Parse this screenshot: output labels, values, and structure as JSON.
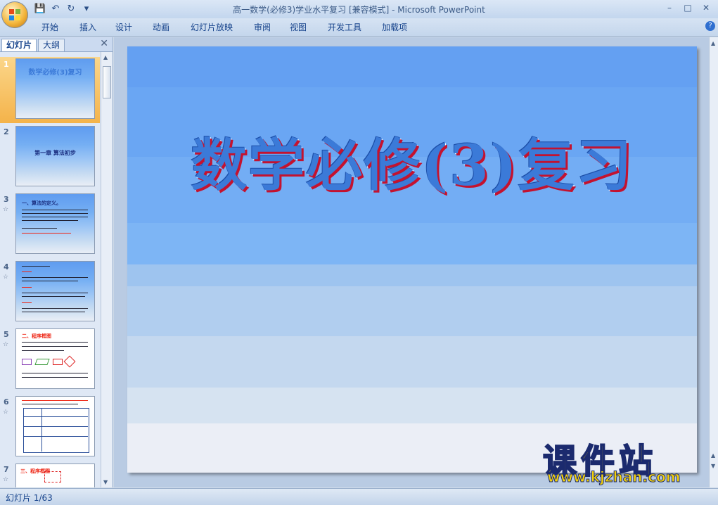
{
  "window": {
    "title": "高一数学(必修3)学业水平复习 [兼容模式] - Microsoft PowerPoint"
  },
  "qat": {
    "save_icon": "save-icon",
    "undo_icon": "undo-icon",
    "redo_icon": "redo-icon",
    "more_icon": "chevron-down-icon"
  },
  "ribbon_tabs": [
    "开始",
    "插入",
    "设计",
    "动画",
    "幻灯片放映",
    "审阅",
    "视图",
    "开发工具",
    "加载项"
  ],
  "panel_tabs": {
    "slides": "幻灯片",
    "outline": "大纲"
  },
  "thumbnails": [
    {
      "num": "1",
      "title": "数学必修(3)复习"
    },
    {
      "num": "2",
      "title": "第一章 算法初步"
    },
    {
      "num": "3",
      "title": "一、算法的定义。"
    },
    {
      "num": "4",
      "title": ""
    },
    {
      "num": "5",
      "title": "二、程序框图"
    },
    {
      "num": "6",
      "title": ""
    },
    {
      "num": "7",
      "title": "三、程序框图"
    }
  ],
  "slide": {
    "title": "数学必修(3)复习"
  },
  "watermark": {
    "text": "课件站",
    "url": "www.kjzhan.com"
  },
  "status": {
    "slide_info": "幻灯片 1/63"
  },
  "colors": {
    "slide_band_top": "#5f9cf0",
    "accent": "#3b7ad8",
    "title_shadow": "#c4122f"
  }
}
